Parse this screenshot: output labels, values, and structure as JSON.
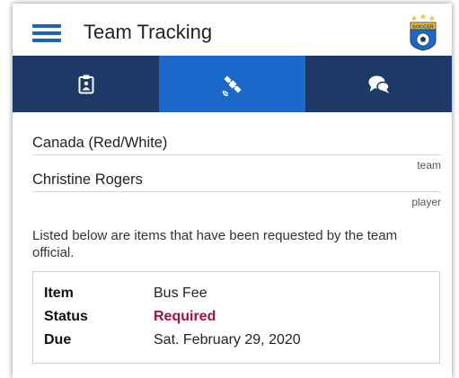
{
  "app_bar": {
    "title": "Team Tracking",
    "menu_icon": "hamburger-menu-icon",
    "logo": {
      "text": "SOCCER",
      "icon": "soccer-ball-crest",
      "accent": "#f2c230"
    }
  },
  "tabs": [
    {
      "icon": "clipboard-icon",
      "active": false
    },
    {
      "icon": "satellite-icon",
      "active": true
    },
    {
      "icon": "chat-bubbles-icon",
      "active": false
    }
  ],
  "fields": {
    "team": {
      "value": "Canada (Red/White)",
      "label": "team"
    },
    "player": {
      "value": "Christine Rogers",
      "label": "player"
    }
  },
  "intro_text": "Listed below are items that have been requested by the team official.",
  "request": {
    "item_label": "Item",
    "item_value": "Bus Fee",
    "status_label": "Status",
    "status_value": "Required",
    "due_label": "Due",
    "due_value": "Sat. February 29, 2020"
  },
  "colors": {
    "tabbar": "#1d3a66",
    "tab_active": "#1a68c9",
    "menu_icon": "#1b64b8",
    "status_required": "#a0113b"
  }
}
